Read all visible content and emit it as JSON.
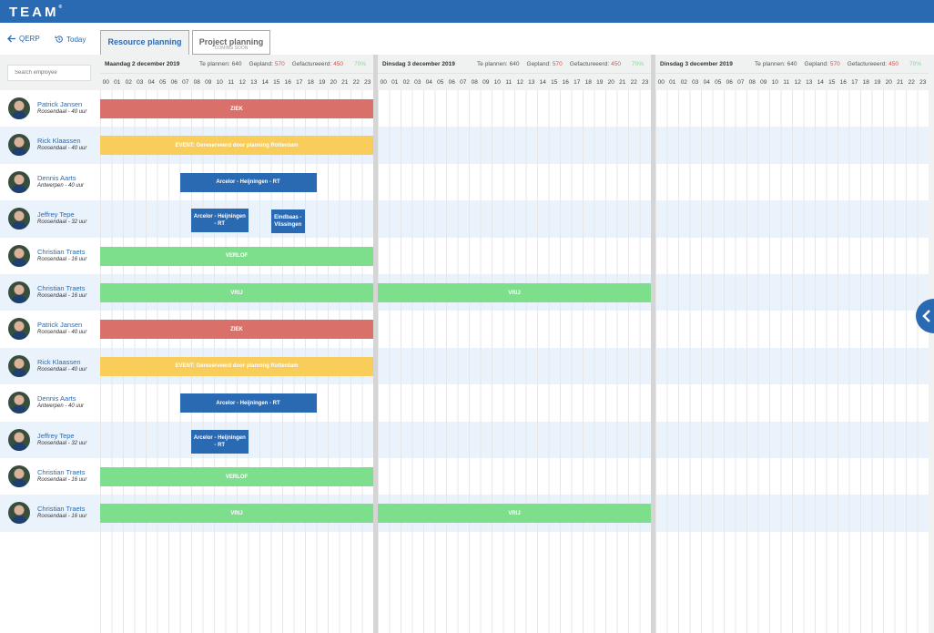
{
  "app": {
    "logo": "TEAM"
  },
  "nav": {
    "back_label": "QERP",
    "today_label": "Today"
  },
  "tabs": [
    {
      "label": "Resource planning",
      "active": true
    },
    {
      "label": "Project planning",
      "sub": "COMING SOON"
    }
  ],
  "search": {
    "placeholder": "Search employee"
  },
  "hours": [
    "00",
    "01",
    "02",
    "03",
    "04",
    "05",
    "06",
    "07",
    "08",
    "09",
    "10",
    "11",
    "12",
    "13",
    "14",
    "15",
    "16",
    "17",
    "18",
    "19",
    "20",
    "21",
    "22",
    "23"
  ],
  "days": [
    {
      "title": "Maandag 2 december 2019",
      "te_plannen_label": "Te plannen:",
      "te_plannen": "640",
      "gepland_label": "Gepland:",
      "gepland": "570",
      "gefactureerd_label": "Gefactureeerd:",
      "gefactureerd": "450",
      "percent": "70%"
    },
    {
      "title": "Dinsdag 3 december 2019",
      "te_plannen_label": "Te plannen:",
      "te_plannen": "640",
      "gepland_label": "Gepland:",
      "gepland": "570",
      "gefactureerd_label": "Gefactureeerd:",
      "gefactureerd": "450",
      "percent": "70%"
    },
    {
      "title": "Dinsdag 3 december 2019",
      "te_plannen_label": "Te plannen:",
      "te_plannen": "640",
      "gepland_label": "Gepland:",
      "gepland": "570",
      "gefactureerd_label": "Gefactureeerd:",
      "gefactureerd": "450",
      "percent": "70%"
    }
  ],
  "colors": {
    "ziek": "#d9706a",
    "event": "#f9cd5a",
    "project": "#2a6ab3",
    "verlof": "#7ddf8c",
    "brand": "#2a6ab3"
  },
  "employees": [
    {
      "name": "Patrick Jansen",
      "detail": "Roosendaal - 40 uur",
      "bars": [
        {
          "day": 0,
          "start": 0,
          "end": 24,
          "label": "ZIEK",
          "type": "ziek"
        }
      ]
    },
    {
      "name": "Rick Klaassen",
      "detail": "Roosendaal - 40 uur",
      "bars": [
        {
          "day": 0,
          "start": 0,
          "end": 24,
          "label": "EVENT: Gereserveerd door planning Rotterdam",
          "type": "event"
        }
      ]
    },
    {
      "name": "Dennis Aarts",
      "detail": "Antwerpen - 40 uur",
      "bars": [
        {
          "day": 0,
          "start": 7,
          "end": 19,
          "label": "Arcelor - Heijningen - RT",
          "type": "project"
        }
      ]
    },
    {
      "name": "Jeffrey Tepe",
      "detail": "Roosendaal - 32 uur",
      "bars": [
        {
          "day": 0,
          "start": 8,
          "end": 13,
          "label": "Arcelor - Heijningen - RT",
          "type": "project"
        },
        {
          "day": 0,
          "start": 15,
          "end": 18,
          "label": "Eindbaas - Vlissingen",
          "type": "project"
        }
      ]
    },
    {
      "name": "Christian Traets",
      "detail": "Roosendaal - 16 uur",
      "bars": [
        {
          "day": 0,
          "start": 0,
          "end": 24,
          "label": "VERLOF",
          "type": "verlof"
        }
      ]
    },
    {
      "name": "Christian Traets",
      "detail": "Roosendaal - 16 uur",
      "bars": [
        {
          "day": 0,
          "start": 0,
          "end": 24,
          "label": "VRIJ",
          "type": "verlof"
        },
        {
          "day": 1,
          "start": 0,
          "end": 24,
          "label": "VRIJ",
          "type": "verlof"
        }
      ]
    },
    {
      "name": "Patrick Jansen",
      "detail": "Roosendaal - 40 uur",
      "bars": [
        {
          "day": 0,
          "start": 0,
          "end": 24,
          "label": "ZIEK",
          "type": "ziek"
        }
      ]
    },
    {
      "name": "Rick Klaassen",
      "detail": "Roosendaal - 40 uur",
      "bars": [
        {
          "day": 0,
          "start": 0,
          "end": 24,
          "label": "EVENT: Gereserveerd door planning Rotterdam",
          "type": "event"
        }
      ]
    },
    {
      "name": "Dennis Aarts",
      "detail": "Antwerpen - 40 uur",
      "bars": [
        {
          "day": 0,
          "start": 7,
          "end": 19,
          "label": "Arcelor - Heijningen - RT",
          "type": "project"
        }
      ]
    },
    {
      "name": "Jeffrey Tepe",
      "detail": "Roosendaal - 32 uur",
      "bars": [
        {
          "day": 0,
          "start": 8,
          "end": 13,
          "label": "Arcelor - Heijningen - RT",
          "type": "project"
        }
      ]
    },
    {
      "name": "Christian Traets",
      "detail": "Roosendaal - 16 uur",
      "bars": [
        {
          "day": 0,
          "start": 0,
          "end": 24,
          "label": "VERLOF",
          "type": "verlof"
        }
      ]
    },
    {
      "name": "Christian Traets",
      "detail": "Roosendaal - 16 uur",
      "bars": [
        {
          "day": 0,
          "start": 0,
          "end": 24,
          "label": "VRIJ",
          "type": "verlof"
        },
        {
          "day": 1,
          "start": 0,
          "end": 24,
          "label": "VRIJ",
          "type": "verlof"
        }
      ]
    }
  ]
}
